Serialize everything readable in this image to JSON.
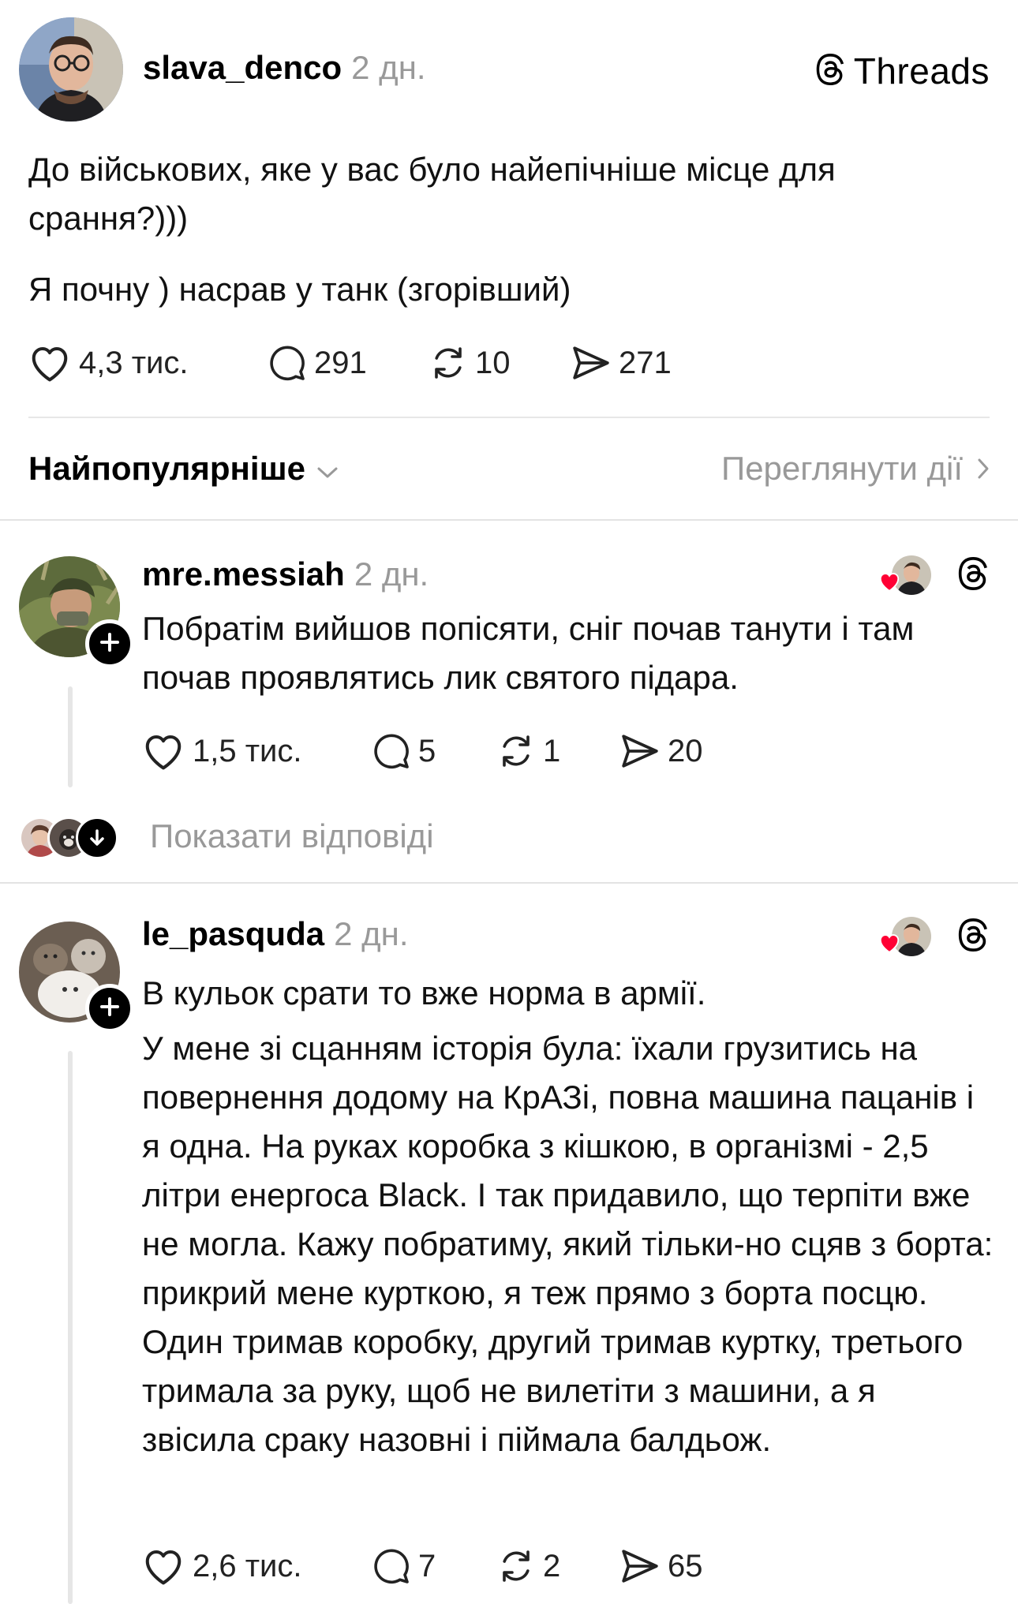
{
  "post": {
    "username": "slava_denco",
    "time": "2 дн.",
    "brand": "Threads",
    "paragraphs": [
      "До військових, яке у вас було найепічніше місце для срання?)))",
      "Я почну ) насрав у танк (згорівший)"
    ],
    "stats": {
      "likes": "4,3 тис.",
      "comments": "291",
      "reposts": "10",
      "shares": "271"
    }
  },
  "sort": {
    "label": "Найпопулярніше",
    "view_activity": "Переглянути дії"
  },
  "replies": [
    {
      "username": "mre.messiah",
      "time": "2 дн.",
      "text": "Побратім вийшов попісяти, сніг почав танути і там почав проявлятись лик святого підара.",
      "stats": {
        "likes": "1,5 тис.",
        "comments": "5",
        "reposts": "1",
        "shares": "20"
      },
      "show_replies": "Показати відповіді"
    },
    {
      "username": "le_pasquda",
      "time": "2 дн.",
      "paragraphs": [
        "В кульок срати то вже норма в армії.",
        "У мене зі сцанням історія була: їхали грузитись на повернення додому на КрАЗі, повна машина пацанів і я одна. На руках коробка з кішкою, в організмі - 2,5 літри енергоса Black. І так придавило, що терпіти вже не могла. Кажу побратиму, який тільки-но сцяв з борта: прикрий мене курткою, я теж прямо з борта посцю. Один тримав коробку, другий тримав куртку, третього тримала за руку, щоб не вилетіти з машини, а я звісила сраку назовні і піймала балдьож."
      ],
      "stats": {
        "likes": "2,6 тис.",
        "comments": "7",
        "reposts": "2",
        "shares": "65"
      }
    }
  ],
  "icons": {
    "like": "heart-outline-icon",
    "comment": "comment-bubble-icon",
    "repost": "repost-icon",
    "share": "send-icon",
    "brand": "threads-logo-icon",
    "liked_by_author": "red-heart-icon",
    "follow": "plus-icon"
  },
  "colors": {
    "text": "#000000",
    "muted": "#999999",
    "heart": "#ff0034",
    "divider": "#e3e3e3"
  }
}
